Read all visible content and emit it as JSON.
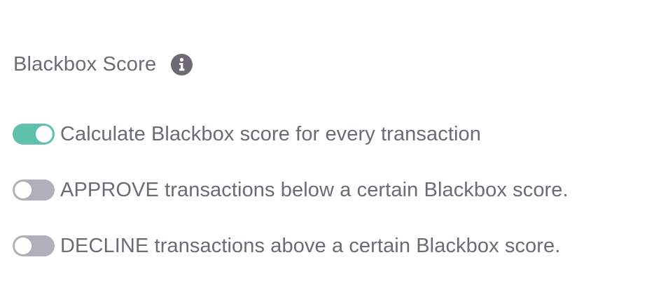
{
  "section": {
    "title": "Blackbox Score",
    "info_icon": "info-circle-icon"
  },
  "colors": {
    "text": "#6d6a75",
    "toggle_on": "#5ec1ad",
    "toggle_off": "#aeb1b9",
    "icon": "#6d6a75"
  },
  "toggles": [
    {
      "label": "Calculate Blackbox score for every transaction",
      "state": "on"
    },
    {
      "label": "APPROVE transactions below a certain Blackbox score.",
      "state": "off"
    },
    {
      "label": "DECLINE transactions above a certain Blackbox score.",
      "state": "off"
    }
  ]
}
